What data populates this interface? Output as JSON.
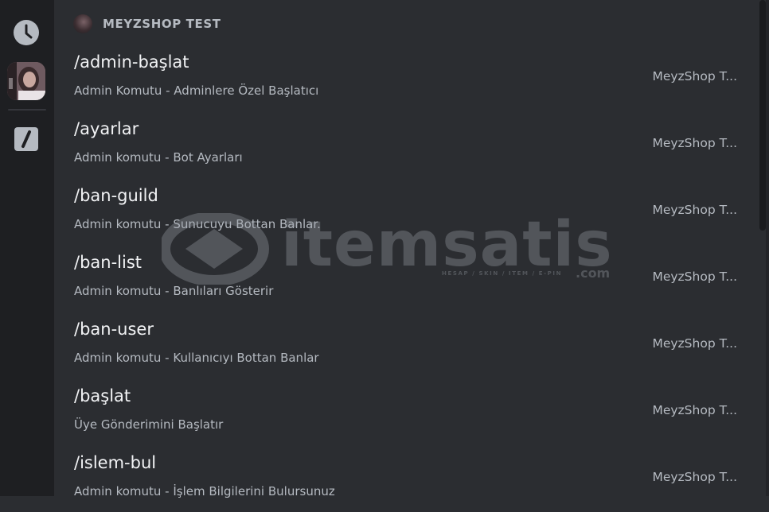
{
  "rail": {
    "icons": [
      "clock-icon",
      "slash-command-icon"
    ]
  },
  "header": {
    "title": "MEYZSHOP TEST"
  },
  "commands": [
    {
      "name": "/admin-başlat",
      "description": "Admin Komutu - Adminlere Özel Başlatıcı",
      "source": "MeyzShop T..."
    },
    {
      "name": "/ayarlar",
      "description": "Admin komutu - Bot Ayarları",
      "source": "MeyzShop T..."
    },
    {
      "name": "/ban-guild",
      "description": "Admin komutu - Sunucuyu Bottan Banlar.",
      "source": "MeyzShop T..."
    },
    {
      "name": "/ban-list",
      "description": "Admin komutu - Banlıları Gösterir",
      "source": "MeyzShop T..."
    },
    {
      "name": "/ban-user",
      "description": "Admin komutu - Kullanıcıyı Bottan Banlar",
      "source": "MeyzShop T..."
    },
    {
      "name": "/başlat",
      "description": "Üye Gönderimini Başlatır",
      "source": "MeyzShop T..."
    },
    {
      "name": "/islem-bul",
      "description": "Admin komutu - İşlem Bilgilerini Bulursunuz",
      "source": "MeyzShop T..."
    }
  ],
  "watermark": {
    "text": "itemsatis",
    "subtitle": "HESAP / SKIN / ITEM / E-PIN",
    "suffix": ".com"
  },
  "colors": {
    "background": "#2b2d31",
    "rail": "#1e1f22",
    "text_primary": "#f2f3f5",
    "text_secondary": "#b5bac1"
  }
}
